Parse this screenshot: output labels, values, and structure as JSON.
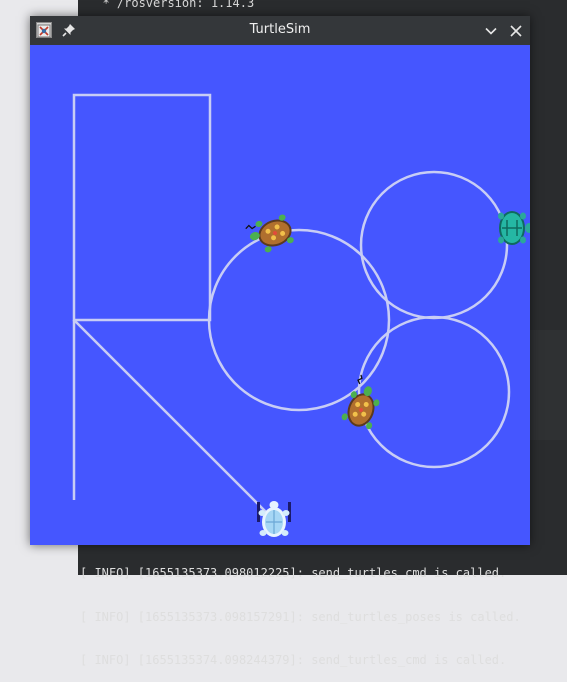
{
  "terminal": {
    "top_line": "  * /rosversion: 1.14.3",
    "log_lines": [
      "[ INFO] [1655135373.098012225]: send_turtles_cmd is called.",
      "[ INFO] [1655135373.098157291]: send_turtles_poses is called.",
      "[ INFO] [1655135374.098244379]: send_turtles_cmd is called."
    ]
  },
  "window": {
    "title": "TurtleSim",
    "app_icon": "turtlesim-app-icon",
    "pin_icon": "pin-icon",
    "minimize_icon": "chevron-down-icon",
    "close_icon": "close-icon"
  },
  "canvas": {
    "background": "#4556ff",
    "trail_color": "#c8cdf5",
    "turtles": [
      {
        "name": "turtle-top-center",
        "style": "brown-spotted"
      },
      {
        "name": "turtle-right-edge",
        "style": "teal"
      },
      {
        "name": "turtle-middle-lower",
        "style": "brown-spotted"
      },
      {
        "name": "turtle-bottom",
        "style": "light-blue"
      }
    ]
  }
}
